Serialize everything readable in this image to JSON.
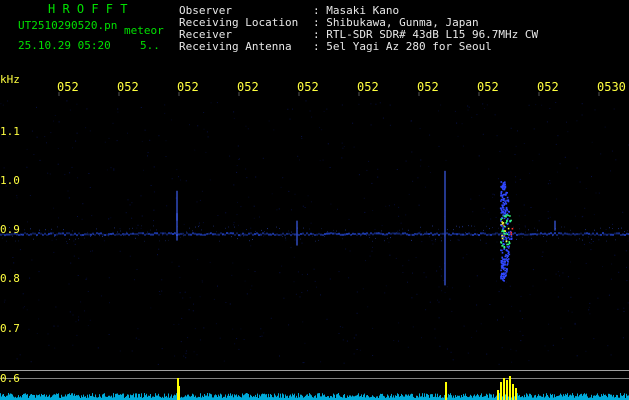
{
  "header": {
    "logo_text": "H R O F F T",
    "filename": "UT2510290520.pn",
    "tag": "meteor",
    "datetime": "25.10.29 05:20",
    "count": "5..",
    "labels": {
      "observer": "Observer",
      "location": "Receiving Location",
      "receiver": "Receiver",
      "antenna": "Receiving Antenna"
    },
    "values": {
      "observer": ": Masaki Kano",
      "location": ": Shibukawa, Gunma, Japan",
      "receiver": ": RTL-SDR SDR# 43dB L15 96.7MHz CW",
      "antenna": ": 5el Yagi Az 280 for Seoul"
    }
  },
  "axes": {
    "y_unit": "kHz",
    "y_ticks": [
      "1.1",
      "1.0",
      "0.9",
      "0.8",
      "0.7",
      "0.6"
    ],
    "x_ticks": [
      "052",
      "052",
      "052",
      "052",
      "052",
      "052",
      "052",
      "052",
      "052",
      "0530"
    ]
  },
  "colors": {
    "background": "#000000",
    "header_left": "#00e000",
    "header_right": "#e8e8e8",
    "ticks": "#ffff40",
    "signal_line": "#2040c0",
    "meteor_core": "#ff3030",
    "spectrum": "#00c8ff",
    "spectrum_peak": "#ffff00"
  },
  "spectrogram": {
    "carrier_khz": 0.895,
    "meteor_start_minute": 8.1,
    "meteor_end_minute": 8.3,
    "meteor_top_khz": 1.0,
    "meteor_bottom_khz": 0.8
  }
}
